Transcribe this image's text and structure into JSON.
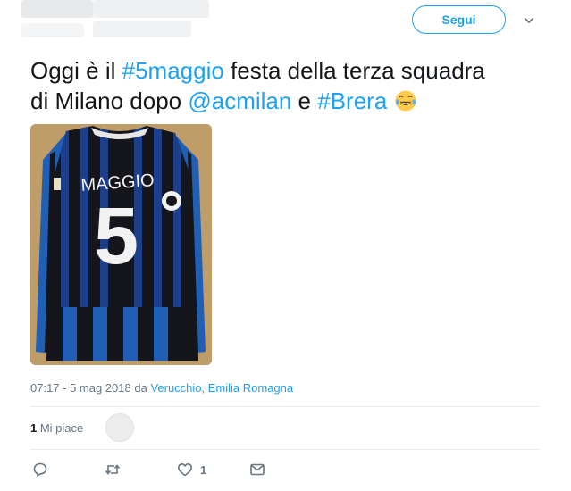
{
  "header": {
    "follow_label": "Segui",
    "caret_icon": "chevron-down-icon"
  },
  "tweet": {
    "line1_pre": "Oggi è il ",
    "hashtag1": "#5maggio",
    "line1_post": " festa della terza squadra",
    "line2_pre": "di Milano dopo ",
    "mention": "@acmilan",
    "middle": " e ",
    "hashtag2": "#Brera",
    "emoji": "face-with-tears-of-joy"
  },
  "photo": {
    "jersey_name": "MAGGIO",
    "jersey_number": "5",
    "colors": {
      "blue": "#1f5fb5",
      "black": "#15161c",
      "background": "#bf9d68"
    }
  },
  "meta": {
    "time_date": "07:17 - 5 mag 2018",
    "da": " da ",
    "location": "Verucchio, Emilia Romagna"
  },
  "likes": {
    "count": "1",
    "label": " Mi piace"
  },
  "actions": {
    "reply_icon": "reply-icon",
    "retweet_icon": "retweet-icon",
    "like_icon": "heart-icon",
    "like_count": "1",
    "dm_icon": "envelope-icon"
  },
  "colors": {
    "accent": "#1da1f2",
    "muted": "#657786",
    "text": "#14171a"
  }
}
